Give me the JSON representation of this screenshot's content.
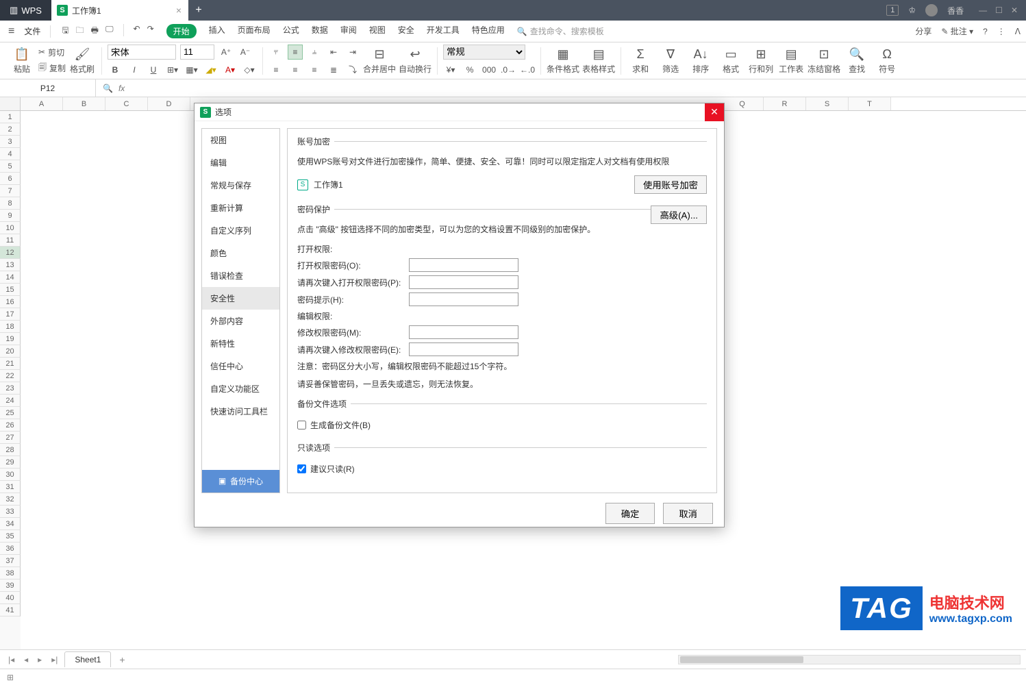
{
  "titlebar": {
    "app_name": "WPS",
    "tab_name": "工作簿1",
    "badge": "1",
    "user_name": "香香"
  },
  "menubar": {
    "file": "文件",
    "tabs": [
      "开始",
      "插入",
      "页面布局",
      "公式",
      "数据",
      "审阅",
      "视图",
      "安全",
      "开发工具",
      "特色应用"
    ],
    "search_placeholder": "查找命令、搜索模板",
    "share": "分享",
    "comment": "批注"
  },
  "ribbon": {
    "paste": "粘贴",
    "cut": "剪切",
    "copy": "复制",
    "format_painter": "格式刷",
    "font_name": "宋体",
    "font_size": "11",
    "merge_center": "合并居中",
    "auto_wrap": "自动换行",
    "number_format": "常规",
    "cond_format": "条件格式",
    "table_style": "表格样式",
    "sum": "求和",
    "filter": "筛选",
    "sort": "排序",
    "format": "格式",
    "rows_cols": "行和列",
    "worksheet": "工作表",
    "freeze": "冻结窗格",
    "find": "查找",
    "symbol": "符号"
  },
  "formulabar": {
    "cell_ref": "P12"
  },
  "grid": {
    "columns": [
      "A",
      "B",
      "C",
      "D",
      "Q",
      "R",
      "S",
      "T"
    ],
    "selected_row": 12
  },
  "sheettabs": {
    "sheet1": "Sheet1"
  },
  "dialog": {
    "title": "选项",
    "sidebar": {
      "items": [
        "视图",
        "编辑",
        "常规与保存",
        "重新计算",
        "自定义序列",
        "颜色",
        "错误检查",
        "安全性",
        "外部内容",
        "新特性",
        "信任中心",
        "自定义功能区",
        "快速访问工具栏"
      ],
      "selected_index": 7,
      "backup": "备份中心"
    },
    "content": {
      "section1_title": "账号加密",
      "section1_desc": "使用WPS账号对文件进行加密操作，简单、便捷、安全、可靠！同时可以限定指定人对文档有使用权限",
      "file_name": "工作簿1",
      "use_account_encrypt": "使用账号加密",
      "section2_title": "密码保护",
      "section2_desc": "点击 \"高级\" 按钮选择不同的加密类型，可以为您的文档设置不同级别的加密保护。",
      "advanced": "高级(A)...",
      "open_perm_title": "打开权限:",
      "open_pwd_label": "打开权限密码(O):",
      "open_pwd_confirm_label": "请再次键入打开权限密码(P):",
      "pwd_hint_label": "密码提示(H):",
      "edit_perm_title": "编辑权限:",
      "edit_pwd_label": "修改权限密码(M):",
      "edit_pwd_confirm_label": "请再次键入修改权限密码(E):",
      "note_line1": "注意：密码区分大小写，编辑权限密码不能超过15个字符。",
      "note_line2": "请妥善保管密码，一旦丢失或遗忘，则无法恢复。",
      "section3_title": "备份文件选项",
      "gen_backup": "生成备份文件(B)",
      "section4_title": "只读选项",
      "suggest_readonly": "建议只读(R)"
    },
    "footer": {
      "ok": "确定",
      "cancel": "取消"
    }
  },
  "watermark": {
    "tag": "TAG",
    "line1": "电脑技术网",
    "line2": "www.tagxp.com"
  }
}
